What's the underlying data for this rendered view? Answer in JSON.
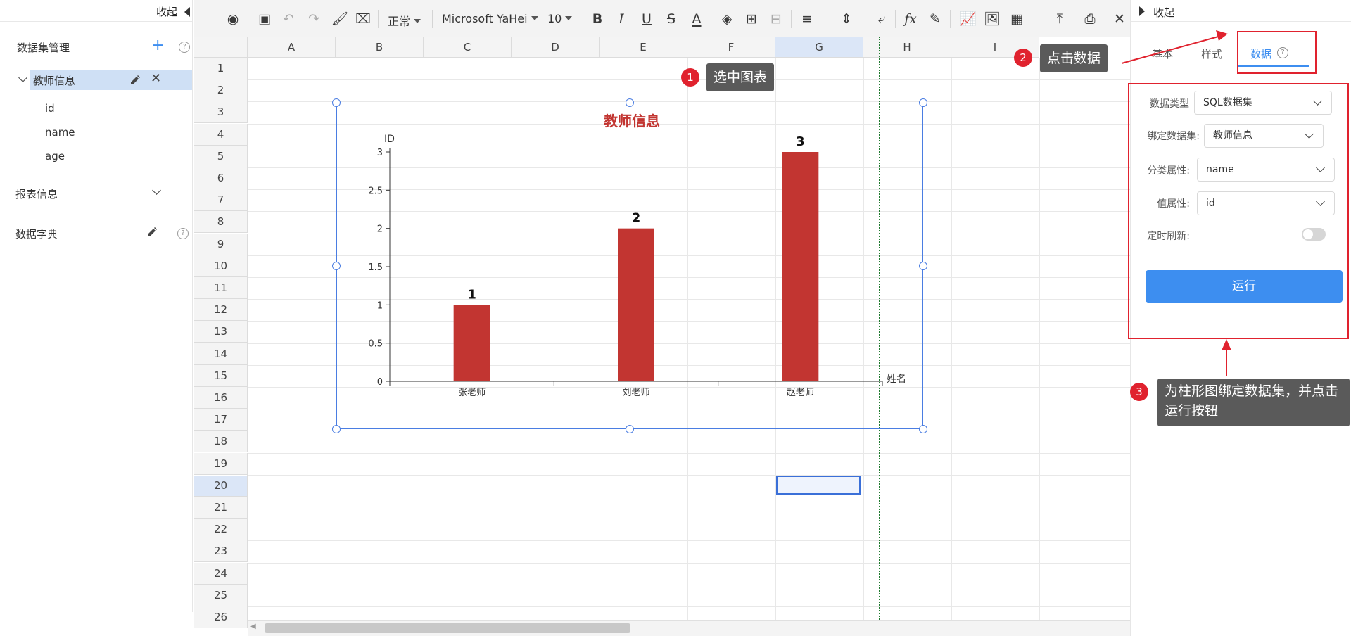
{
  "left_panel": {
    "collapse_label": "收起",
    "dataset_management": "数据集管理",
    "dataset_tree": {
      "name": "教师信息",
      "fields": [
        "id",
        "name",
        "age"
      ]
    },
    "report_info": "报表信息",
    "data_dictionary": "数据字典"
  },
  "toolbar": {
    "style_select": "正常",
    "font_select": "Microsoft YaHei",
    "size_select": "10",
    "bold": "B",
    "italic": "I",
    "underline": "U",
    "strike": "S",
    "font_color": "A",
    "formula": "fx"
  },
  "sheet": {
    "columns": [
      "A",
      "B",
      "C",
      "D",
      "E",
      "F",
      "G",
      "H",
      "I"
    ],
    "rows": [
      "1",
      "2",
      "3",
      "4",
      "5",
      "6",
      "7",
      "8",
      "9",
      "10",
      "11",
      "12",
      "13",
      "14",
      "15",
      "16",
      "17",
      "18",
      "19",
      "20",
      "21",
      "22",
      "23",
      "24",
      "25",
      "26"
    ]
  },
  "chart_data": {
    "type": "bar",
    "title": "教师信息",
    "ylabel": "ID",
    "xlabel": "姓名",
    "categories": [
      "张老师",
      "刘老师",
      "赵老师"
    ],
    "values": [
      1,
      2,
      3
    ],
    "data_labels": [
      "1",
      "2",
      "3"
    ],
    "ylim": [
      0,
      3
    ],
    "y_ticks": [
      "0",
      "0.5",
      "1",
      "1.5",
      "2",
      "2.5",
      "3"
    ],
    "bar_color": "#c23531",
    "title_color": "#c23531"
  },
  "right_panel": {
    "collapse_label": "收起",
    "tabs": [
      "基本",
      "样式",
      "数据"
    ],
    "form": {
      "data_type_label": "数据类型",
      "data_type_value": "SQL数据集",
      "bind_dataset_label": "绑定数据集:",
      "bind_dataset_value": "教师信息",
      "category_label": "分类属性:",
      "category_value": "name",
      "value_label": "值属性:",
      "value_value": "id",
      "refresh_label": "定时刷新:",
      "run_button": "运行"
    }
  },
  "annotations": {
    "step1_num": "1",
    "step1_text": "选中图表",
    "step2_num": "2",
    "step2_text": "点击数据",
    "step3_num": "3",
    "step3_text_line1": "为柱形图绑定数据集，并点击",
    "step3_text_line2": "运行按钮",
    "accent_color": "#e0222e"
  }
}
